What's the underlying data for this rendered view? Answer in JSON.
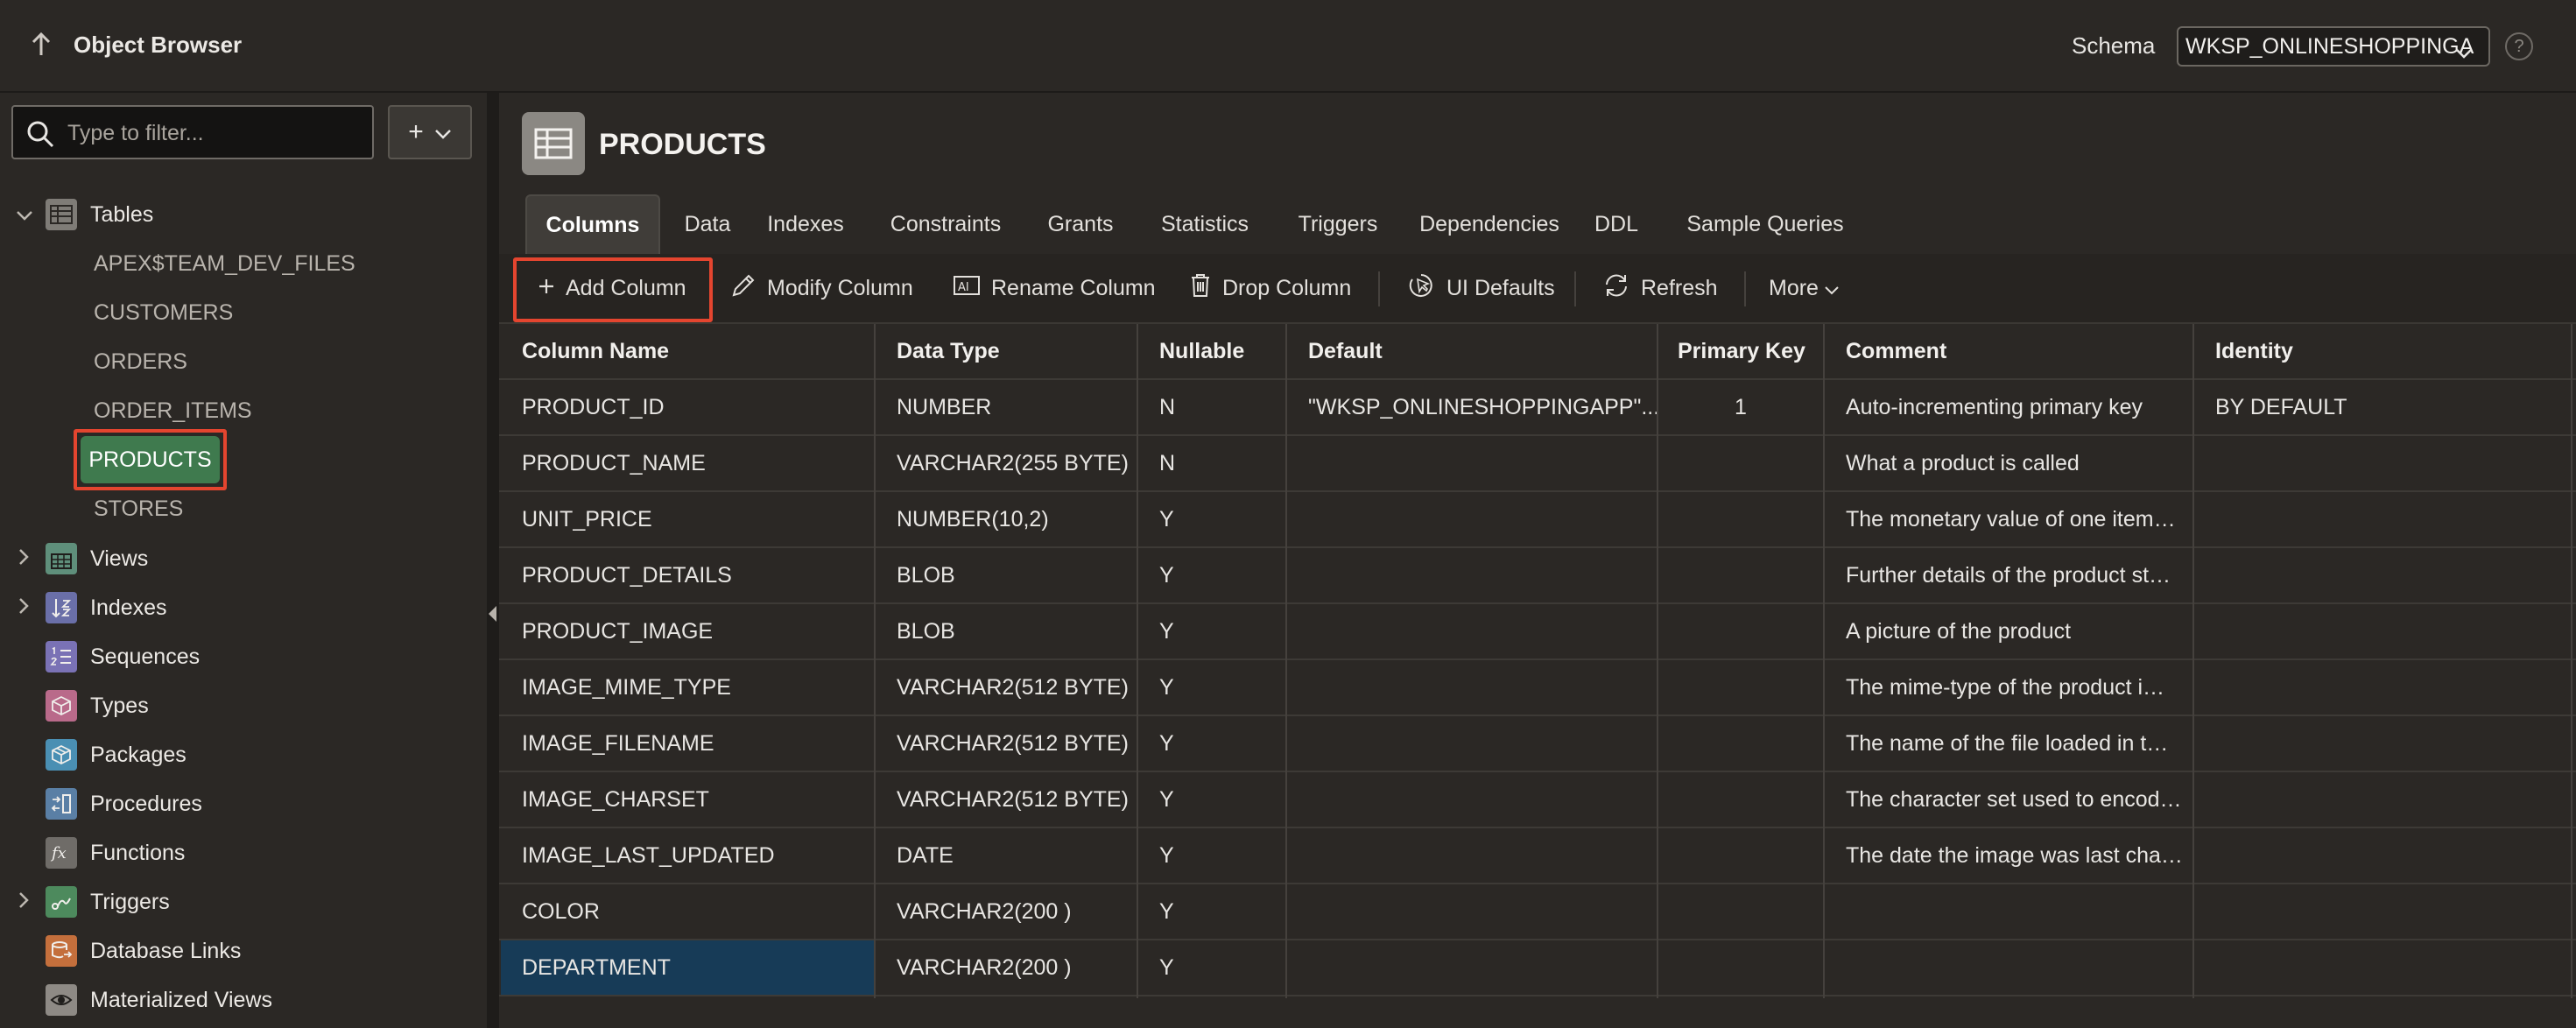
{
  "header": {
    "title": "Object Browser",
    "schema_label": "Schema",
    "schema_value": "WKSP_ONLINESHOPPINGA",
    "help_symbol": "?"
  },
  "sidebar": {
    "filter_placeholder": "Type to filter...",
    "add_symbol": "+",
    "tables_label": "Tables",
    "tables": [
      "APEX$TEAM_DEV_FILES",
      "CUSTOMERS",
      "ORDERS",
      "ORDER_ITEMS",
      "PRODUCTS",
      "STORES"
    ],
    "selected_table": "PRODUCTS",
    "nodes": [
      "Views",
      "Indexes",
      "Sequences",
      "Types",
      "Packages",
      "Procedures",
      "Functions",
      "Triggers",
      "Database Links",
      "Materialized Views"
    ]
  },
  "object": {
    "name": "PRODUCTS"
  },
  "tabs": [
    "Columns",
    "Data",
    "Indexes",
    "Constraints",
    "Grants",
    "Statistics",
    "Triggers",
    "Dependencies",
    "DDL",
    "Sample Queries"
  ],
  "active_tab": "Columns",
  "toolbar": {
    "add_column": "Add Column",
    "modify_column": "Modify Column",
    "rename_column": "Rename Column",
    "drop_column": "Drop Column",
    "ui_defaults": "UI Defaults",
    "refresh": "Refresh",
    "more": "More"
  },
  "columns_grid": {
    "headers": [
      "Column Name",
      "Data Type",
      "Nullable",
      "Default",
      "Primary Key",
      "Comment",
      "Identity"
    ],
    "rows": [
      [
        "PRODUCT_ID",
        "NUMBER",
        "N",
        "\"WKSP_ONLINESHOPPINGAPP\"...",
        "1",
        "Auto-incrementing primary key",
        "BY DEFAULT"
      ],
      [
        "PRODUCT_NAME",
        "VARCHAR2(255 BYTE)",
        "N",
        "",
        "",
        "What a product is called",
        ""
      ],
      [
        "UNIT_PRICE",
        "NUMBER(10,2)",
        "Y",
        "",
        "",
        "The monetary value of one item…",
        ""
      ],
      [
        "PRODUCT_DETAILS",
        "BLOB",
        "Y",
        "",
        "",
        "Further details of the product st…",
        ""
      ],
      [
        "PRODUCT_IMAGE",
        "BLOB",
        "Y",
        "",
        "",
        "A picture of the product",
        ""
      ],
      [
        "IMAGE_MIME_TYPE",
        "VARCHAR2(512 BYTE)",
        "Y",
        "",
        "",
        "The mime-type of the product i…",
        ""
      ],
      [
        "IMAGE_FILENAME",
        "VARCHAR2(512 BYTE)",
        "Y",
        "",
        "",
        "The name of the file loaded in t…",
        ""
      ],
      [
        "IMAGE_CHARSET",
        "VARCHAR2(512 BYTE)",
        "Y",
        "",
        "",
        "The character set used to encod…",
        ""
      ],
      [
        "IMAGE_LAST_UPDATED",
        "DATE",
        "Y",
        "",
        "",
        "The date the image was last cha…",
        ""
      ],
      [
        "COLOR",
        "VARCHAR2(200 )",
        "Y",
        "",
        "",
        "",
        ""
      ],
      [
        "DEPARTMENT",
        "VARCHAR2(200 )",
        "Y",
        "",
        "",
        "",
        ""
      ]
    ]
  },
  "colors": {
    "background": "#2b2825",
    "selected_green": "#3f7a4e",
    "highlight_red": "#e4452f",
    "row_selected_blue": "#173b57"
  }
}
